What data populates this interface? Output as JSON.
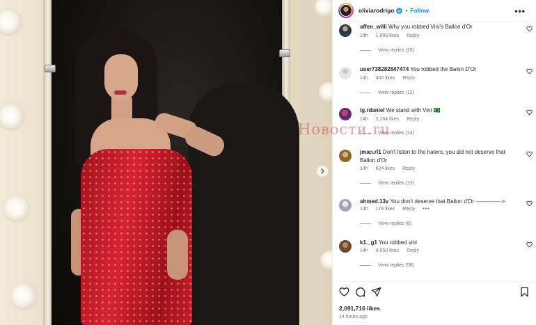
{
  "post": {
    "username": "oliviarodrigo",
    "separator": "•",
    "follow_label": "Follow",
    "more_label": "•••",
    "watermark": "Новости.ru",
    "likes": "2,091,716 likes",
    "time": "14 hours ago"
  },
  "colors": {
    "accent": "#0095f6",
    "verified": "#3897f0",
    "text": "#262626",
    "secondary": "#737373"
  },
  "comments": [
    {
      "username": "affen_willi",
      "text": "Why you robbed Vini's Ballon d'Or",
      "time": "14h",
      "likes": "1,988 likes",
      "reply": "Reply",
      "replies": "View replies (28)",
      "avatar_color": "#27384f"
    },
    {
      "username": "user738282847474",
      "text": "You robbed the Balon D'Or",
      "time": "14h",
      "likes": "400 likes",
      "reply": "Reply",
      "replies": "View replies (12)",
      "avatar_color": "#dadada"
    },
    {
      "username": "ig.rdaniel",
      "text": "We stand with Vini 🇧🇷",
      "time": "14h",
      "likes": "2,164 likes",
      "reply": "Reply",
      "replies": "View replies (24)",
      "avatar_color": "#5b2a7a"
    },
    {
      "username": "jman.rl1",
      "text": "Don't listen to the haters, you did not deserve that Ballon d'Or",
      "time": "14h",
      "likes": "624 likes",
      "reply": "Reply",
      "replies": "View replies (13)",
      "avatar_color": "#8a6a2a"
    },
    {
      "username": "ahmed.13v",
      "text": "You don't deserve that Ballon d'Or -------------->",
      "time": "14h",
      "likes": "178 likes",
      "reply": "Reply",
      "options": "•••",
      "replies": "View replies (8)",
      "avatar_color": "#9aa6b2"
    },
    {
      "username": "k1._g1",
      "text": "You robbed vini",
      "time": "14h",
      "likes": "4,550 likes",
      "reply": "Reply",
      "replies": "View replies (58)",
      "avatar_color": "#6b4a2f"
    }
  ]
}
